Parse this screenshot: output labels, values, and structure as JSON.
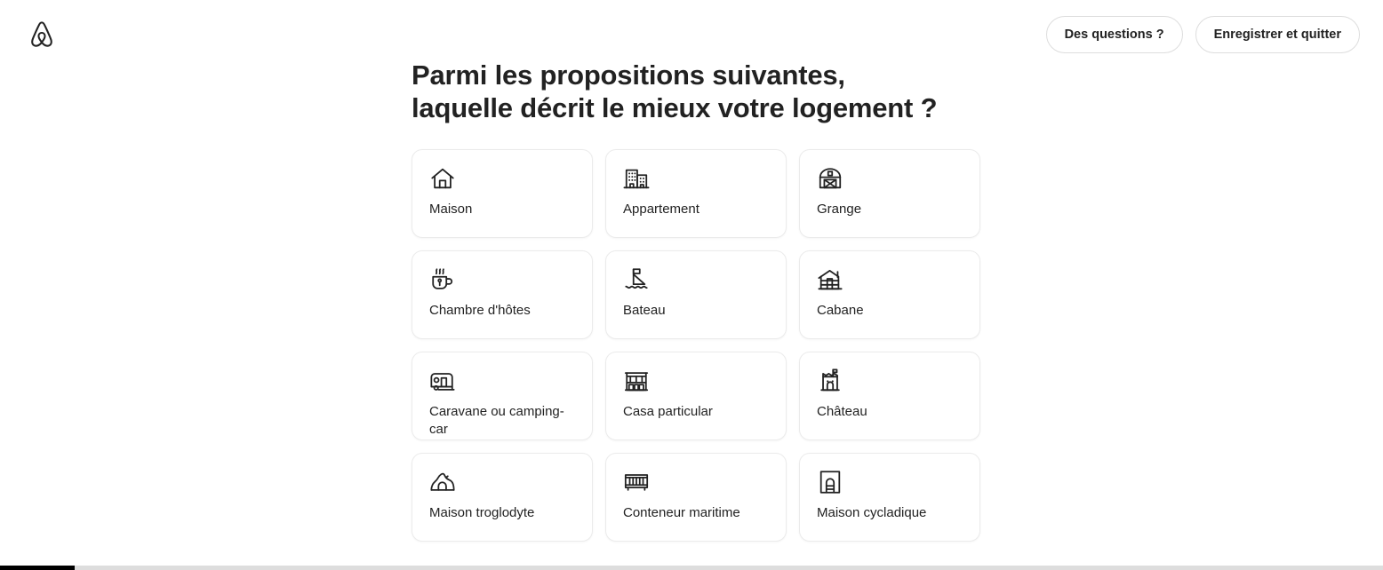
{
  "header": {
    "logo_icon": "airbnb-logo-icon",
    "buttons": [
      {
        "label": "Des questions ?",
        "name": "questions-button"
      },
      {
        "label": "Enregistrer et quitter",
        "name": "save-and-exit-button"
      }
    ]
  },
  "main": {
    "title": "Parmi les propositions suivantes, laquelle décrit le mieux votre logement ?",
    "property_types": [
      {
        "label": "Maison",
        "icon": "house-icon"
      },
      {
        "label": "Appartement",
        "icon": "apartment-building-icon"
      },
      {
        "label": "Grange",
        "icon": "barn-icon"
      },
      {
        "label": "Chambre d'hôtes",
        "icon": "tea-cup-icon"
      },
      {
        "label": "Bateau",
        "icon": "sailboat-icon"
      },
      {
        "label": "Cabane",
        "icon": "log-cabin-icon"
      },
      {
        "label": "Caravane ou camping-car",
        "icon": "caravan-icon"
      },
      {
        "label": "Casa particular",
        "icon": "colonial-facade-icon"
      },
      {
        "label": "Château",
        "icon": "castle-tower-icon"
      },
      {
        "label": "Maison troglodyte",
        "icon": "cave-house-icon"
      },
      {
        "label": "Conteneur maritime",
        "icon": "shipping-container-icon"
      },
      {
        "label": "Maison cycladique",
        "icon": "cycladic-house-icon"
      }
    ]
  },
  "footer": {
    "progress_percent": 5.4,
    "progress_fill_color": "#000000",
    "progress_track_color": "#dddddd"
  },
  "colors": {
    "text": "#222222",
    "card_border": "#ebebeb",
    "pill_border": "#dddddd",
    "background": "#ffffff"
  }
}
